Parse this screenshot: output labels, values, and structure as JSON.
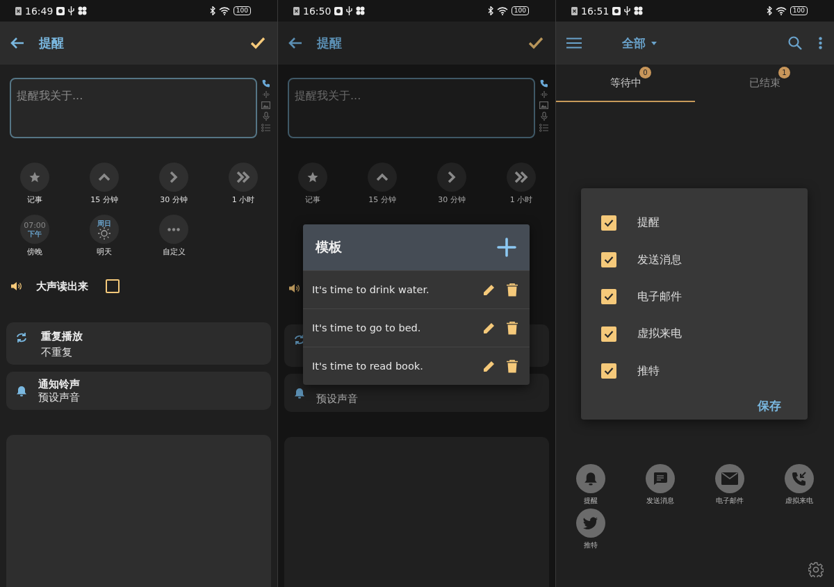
{
  "reminder_editor": {
    "status_bar": {
      "time": "16:49",
      "battery": "100"
    },
    "app_bar": {
      "title": "提醒"
    },
    "input": {
      "placeholder": "提醒我关于..."
    },
    "chips": [
      {
        "kind": "star",
        "label": "记事"
      },
      {
        "kind": "up",
        "label": "15 分钟"
      },
      {
        "kind": "right",
        "label": "30 分钟"
      },
      {
        "kind": "double",
        "label": "1 小时"
      },
      {
        "kind": "time",
        "time": "07:00",
        "period": "下午",
        "label": "傍晚"
      },
      {
        "kind": "sun",
        "day": "周日",
        "label": "明天"
      },
      {
        "kind": "more",
        "label": "自定义"
      }
    ],
    "read_aloud": {
      "label": "大声读出来",
      "checked": false
    },
    "repeat": {
      "title": "重复播放",
      "value": "不重复"
    },
    "notification_sound": {
      "title": "通知铃声",
      "value": "预设声音"
    }
  },
  "template_screen": {
    "status_bar": {
      "time": "16:50",
      "battery": "100"
    },
    "app_bar": {
      "title": "提醒"
    },
    "input": {
      "placeholder": "提醒我关于..."
    },
    "chips": [
      {
        "kind": "star",
        "label": "记事"
      },
      {
        "kind": "up",
        "label": "15 分钟"
      },
      {
        "kind": "right",
        "label": "30 分钟"
      },
      {
        "kind": "double",
        "label": "1 小时"
      }
    ],
    "notification_sound": {
      "value": "预设声音"
    },
    "dialog": {
      "title": "模板",
      "templates": [
        "It's time to drink water.",
        "It's time to go to bed.",
        "It's time to read book."
      ]
    }
  },
  "reminder_list": {
    "status_bar": {
      "time": "16:51",
      "battery": "100"
    },
    "app_bar": {
      "filter": "全部"
    },
    "tabs": [
      {
        "label": "等待中",
        "count": "0",
        "selected": true
      },
      {
        "label": "已结束",
        "count": "1",
        "selected": false
      }
    ],
    "dialog": {
      "options": [
        {
          "label": "提醒",
          "checked": true
        },
        {
          "label": "发送消息",
          "checked": true
        },
        {
          "label": "电子邮件",
          "checked": true
        },
        {
          "label": "虚拟来电",
          "checked": true
        },
        {
          "label": "推特",
          "checked": true
        }
      ],
      "save": "保存"
    },
    "types": [
      {
        "kind": "bell",
        "label": "提醒"
      },
      {
        "kind": "message",
        "label": "发送消息"
      },
      {
        "kind": "mail",
        "label": "电子邮件"
      },
      {
        "kind": "call",
        "label": "虚拟来电"
      },
      {
        "kind": "bird",
        "label": "推特"
      }
    ]
  }
}
